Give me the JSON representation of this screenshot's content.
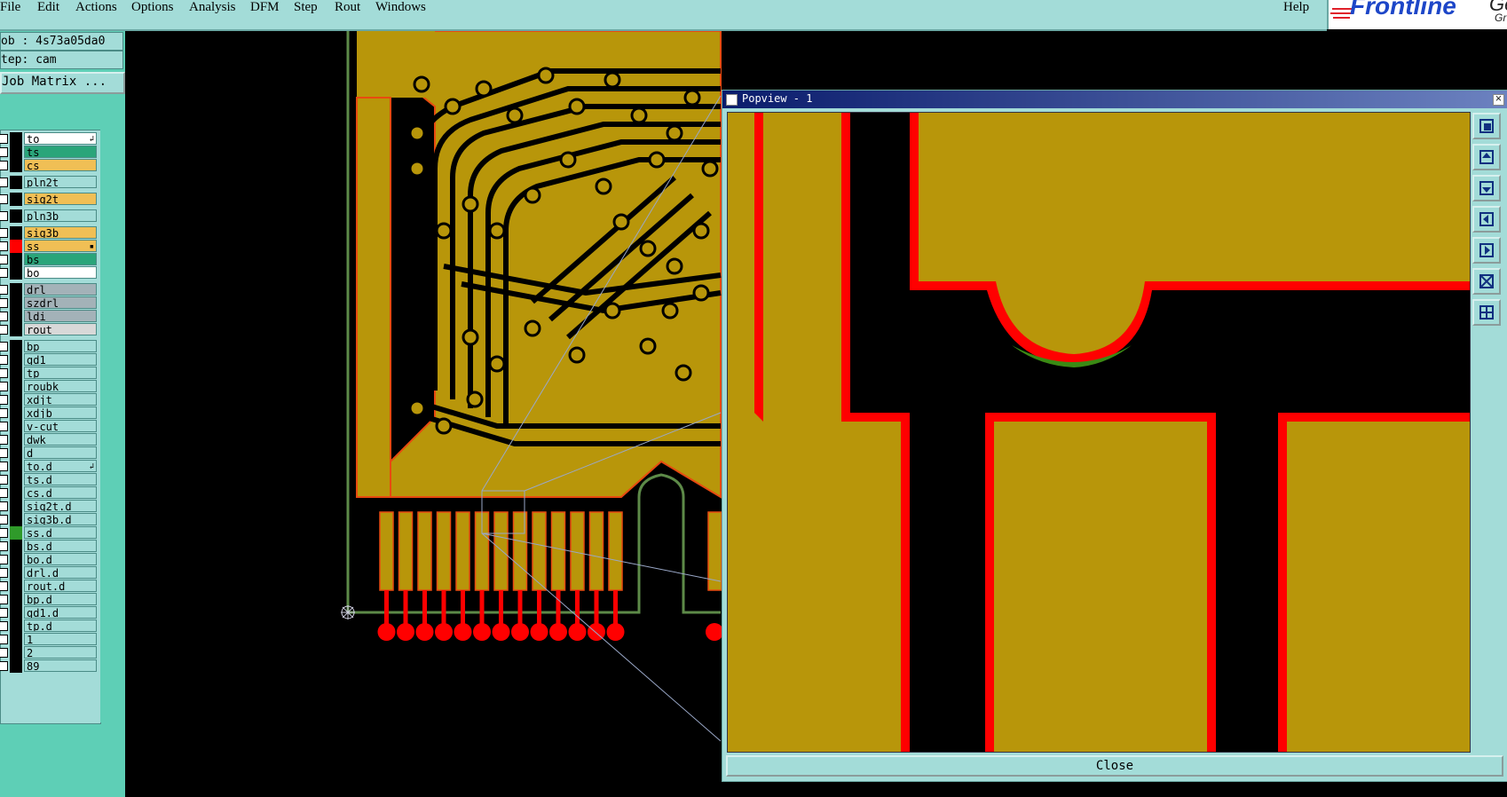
{
  "menu": {
    "items": [
      "File",
      "Edit",
      "Actions",
      "Options",
      "Analysis",
      "DFM",
      "Step",
      "Rout",
      "Windows"
    ],
    "help": "Help"
  },
  "logo": {
    "text": "Frontline",
    "suffix": "Ge",
    "suffix2": "Gr"
  },
  "info": {
    "job": "ob : 4s73a05da0",
    "step": "tep: cam",
    "matrix_button": "Job Matrix ..."
  },
  "layers": [
    {
      "name": "to",
      "swatch": "#000000",
      "bg": "#ffffff",
      "mark": "↲"
    },
    {
      "name": "ts",
      "swatch": "#000000",
      "bg": "#2aa57a",
      "mark": ""
    },
    {
      "name": "cs",
      "swatch": "#000000",
      "bg": "#f0bf55",
      "mark": ""
    },
    {
      "name": "pln2t",
      "swatch": "#000000",
      "bg": "#a3dcd8",
      "mark": ""
    },
    {
      "name": "sig2t",
      "swatch": "#000000",
      "bg": "#f0bf55",
      "mark": ""
    },
    {
      "name": "pln3b",
      "swatch": "#000000",
      "bg": "#a3dcd8",
      "mark": ""
    },
    {
      "name": "sig3b",
      "swatch": "#000000",
      "bg": "#f0bf55",
      "mark": ""
    },
    {
      "name": "ss",
      "swatch": "#ff0000",
      "bg": "#f0bf55",
      "mark": "▪"
    },
    {
      "name": "bs",
      "swatch": "#000000",
      "bg": "#2aa57a",
      "mark": ""
    },
    {
      "name": "bo",
      "swatch": "#000000",
      "bg": "#ffffff",
      "mark": ""
    },
    {
      "name": "drl",
      "swatch": "#000000",
      "bg": "#a3b2b8",
      "mark": ""
    },
    {
      "name": "szdrl",
      "swatch": "#000000",
      "bg": "#a3b2b8",
      "mark": ""
    },
    {
      "name": "ldi",
      "swatch": "#000000",
      "bg": "#a3b2b8",
      "mark": ""
    },
    {
      "name": "rout",
      "swatch": "#000000",
      "bg": "#d8d8d8",
      "mark": ""
    },
    {
      "name": "bp",
      "swatch": "#000000",
      "bg": "#a3dcd8",
      "mark": ""
    },
    {
      "name": "gd1",
      "swatch": "#000000",
      "bg": "#a3dcd8",
      "mark": ""
    },
    {
      "name": "tp",
      "swatch": "#000000",
      "bg": "#a3dcd8",
      "mark": ""
    },
    {
      "name": "roubk",
      "swatch": "#000000",
      "bg": "#a3dcd8",
      "mark": ""
    },
    {
      "name": "xdjt",
      "swatch": "#000000",
      "bg": "#a3dcd8",
      "mark": ""
    },
    {
      "name": "xdjb",
      "swatch": "#000000",
      "bg": "#a3dcd8",
      "mark": ""
    },
    {
      "name": "v-cut",
      "swatch": "#000000",
      "bg": "#a3dcd8",
      "mark": ""
    },
    {
      "name": "dwk",
      "swatch": "#000000",
      "bg": "#a3dcd8",
      "mark": ""
    },
    {
      "name": "d",
      "swatch": "#000000",
      "bg": "#a3dcd8",
      "mark": ""
    },
    {
      "name": "to.d",
      "swatch": "#000000",
      "bg": "#a3dcd8",
      "mark": "↲"
    },
    {
      "name": "ts.d",
      "swatch": "#000000",
      "bg": "#a3dcd8",
      "mark": ""
    },
    {
      "name": "cs.d",
      "swatch": "#000000",
      "bg": "#a3dcd8",
      "mark": ""
    },
    {
      "name": "sig2t.d",
      "swatch": "#000000",
      "bg": "#a3dcd8",
      "mark": ""
    },
    {
      "name": "sig3b.d",
      "swatch": "#000000",
      "bg": "#a3dcd8",
      "mark": ""
    },
    {
      "name": "ss.d",
      "swatch": "#2f9a2a",
      "bg": "#a3dcd8",
      "mark": ""
    },
    {
      "name": "bs.d",
      "swatch": "#000000",
      "bg": "#a3dcd8",
      "mark": ""
    },
    {
      "name": "bo.d",
      "swatch": "#000000",
      "bg": "#a3dcd8",
      "mark": ""
    },
    {
      "name": "drl.d",
      "swatch": "#000000",
      "bg": "#a3dcd8",
      "mark": ""
    },
    {
      "name": "rout.d",
      "swatch": "#000000",
      "bg": "#a3dcd8",
      "mark": ""
    },
    {
      "name": "bp.d",
      "swatch": "#000000",
      "bg": "#a3dcd8",
      "mark": ""
    },
    {
      "name": "gd1.d",
      "swatch": "#000000",
      "bg": "#a3dcd8",
      "mark": ""
    },
    {
      "name": "tp.d",
      "swatch": "#000000",
      "bg": "#a3dcd8",
      "mark": ""
    },
    {
      "name": "1",
      "swatch": "#000000",
      "bg": "#a3dcd8",
      "mark": ""
    },
    {
      "name": "2",
      "swatch": "#000000",
      "bg": "#a3dcd8",
      "mark": ""
    },
    {
      "name": "89",
      "swatch": "#000000",
      "bg": "#a3dcd8",
      "mark": ""
    }
  ],
  "popview": {
    "title": "Popview - 1",
    "close_label": "Close",
    "tool_icons": [
      "fit-window-icon",
      "pan-up-icon",
      "pan-down-icon",
      "pan-left-icon",
      "pan-right-icon",
      "zoom-out-icon",
      "zoom-in-icon"
    ]
  },
  "colors": {
    "copper": "#b8960a",
    "copper_outline": "#e84a10",
    "soldermask": "#ff0000",
    "ui_bg": "#a3dcd8",
    "panel_bg": "#5ecfb6"
  }
}
